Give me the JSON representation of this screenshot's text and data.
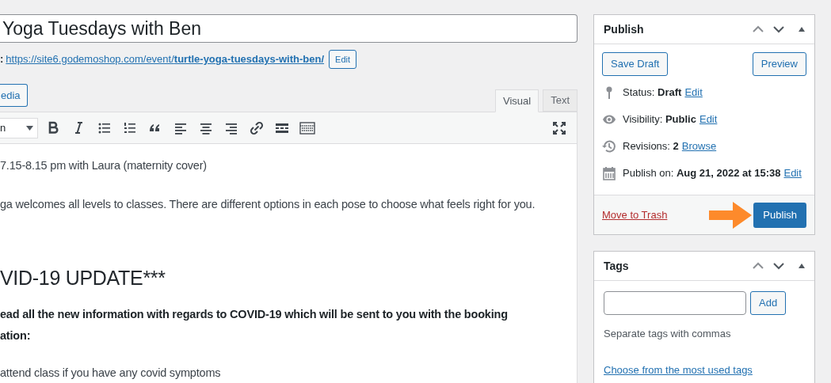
{
  "title_field": {
    "value": "Yoga Tuesdays with Ben"
  },
  "permalink": {
    "label": ":",
    "url_base": "https://site6.godemoshop.com/event/",
    "slug": "turtle-yoga-tuesdays-with-ben/",
    "edit_button": "Edit"
  },
  "add_media_button": "edia",
  "editor_tabs": [
    {
      "label": "Visual",
      "selected": true
    },
    {
      "label": "Text",
      "selected": false
    }
  ],
  "format_select": {
    "value": "n"
  },
  "content": [
    {
      "kind": "para",
      "lines": [
        "7.15-8.15 pm with Laura (maternity cover)"
      ]
    },
    {
      "kind": "para",
      "lines": [
        "ga welcomes all levels to classes. There are different options in each pose to choose what feels right for you."
      ]
    },
    {
      "kind": "heading",
      "lines": [
        "VID-19 UPDATE***"
      ]
    },
    {
      "kind": "bold",
      "lines": [
        "ead all the new information with regards to COVID-19 which will be sent to you with the booking",
        "ation:"
      ]
    },
    {
      "kind": "para",
      "lines": [
        "attend class if you have any covid symptoms"
      ]
    }
  ],
  "publish_box": {
    "title": "Publish",
    "save_draft": "Save Draft",
    "preview": "Preview",
    "rows": [
      {
        "kind": "pin",
        "label": "Status:",
        "value": "Draft",
        "link": "Edit"
      },
      {
        "kind": "eye",
        "label": "Visibility:",
        "value": "Public",
        "link": "Edit"
      },
      {
        "kind": "history",
        "label": "Revisions:",
        "value": "2",
        "link": "Browse"
      },
      {
        "kind": "calendar",
        "label": "Publish on:",
        "value": "Aug 21, 2022 at 15:38",
        "link": "Edit"
      }
    ],
    "trash_link": "Move to Trash",
    "publish_button": "Publish"
  },
  "tags_box": {
    "title": "Tags",
    "add_button": "Add",
    "hint": "Separate tags with commas",
    "choose_link": "Choose from the most used tags"
  }
}
